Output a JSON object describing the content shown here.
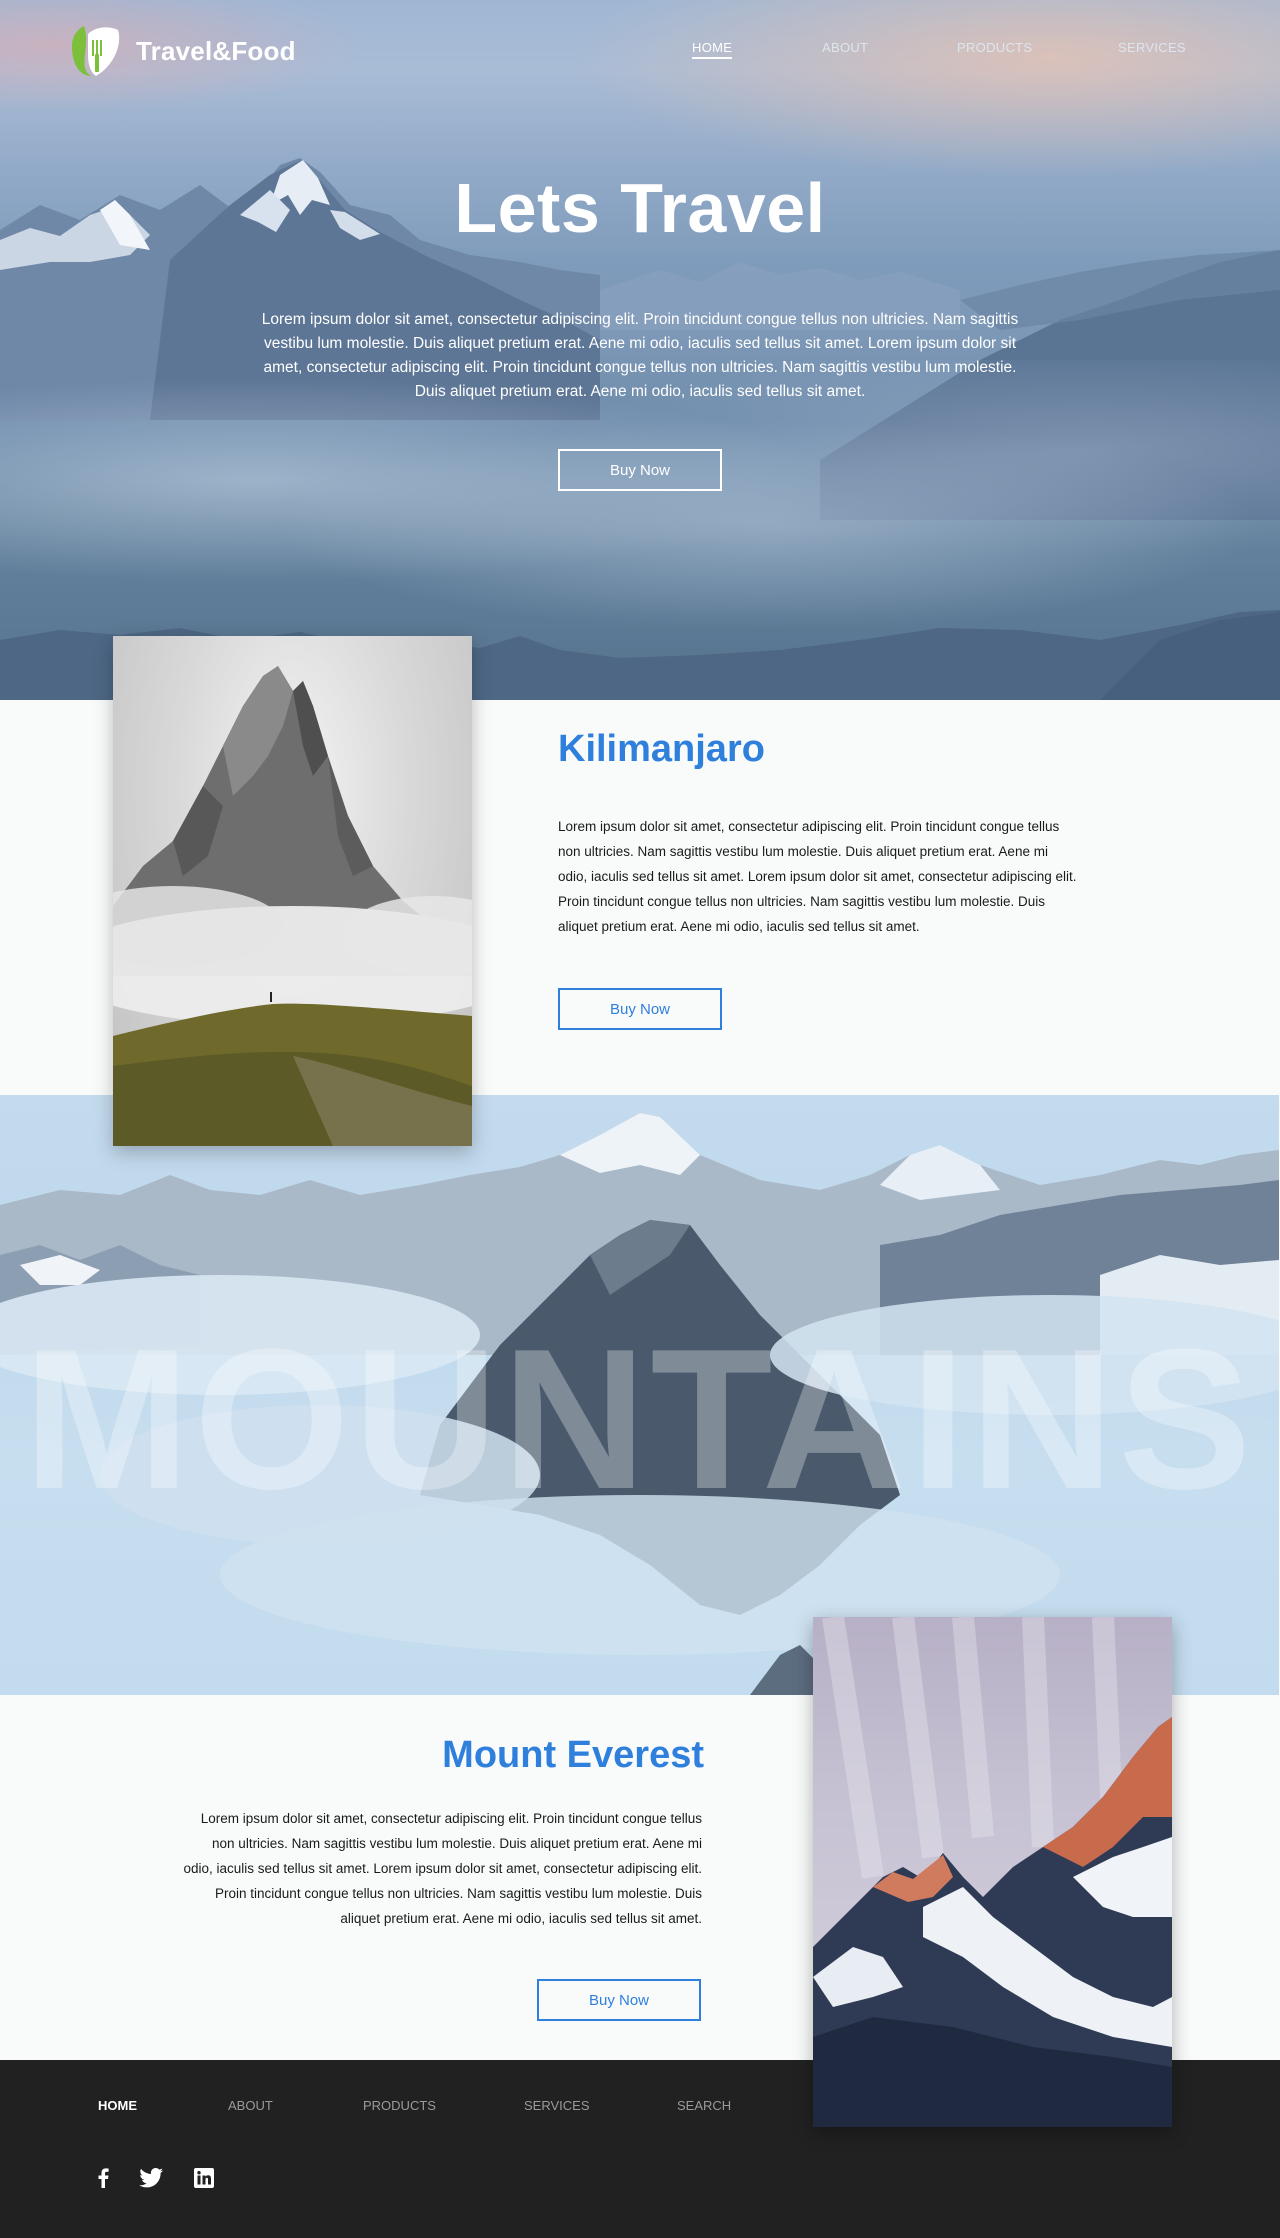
{
  "brand": {
    "name": "Travel&Food",
    "logo_icon": "leaf-fork-icon"
  },
  "nav": {
    "items": [
      "HOME",
      "ABOUT",
      "PRODUCTS",
      "SERVICES"
    ],
    "active": "HOME"
  },
  "hero": {
    "title": "Lets Travel",
    "text": "Lorem ipsum dolor sit amet, consectetur adipiscing elit. Proin tincidunt congue tellus non ultricies. Nam sagittis vestibu lum molestie. Duis aliquet pretium erat. Aene mi odio, iaculis sed tellus sit amet. Lorem ipsum dolor sit amet, consectetur adipiscing elit. Proin tincidunt congue tellus non ultricies. Nam sagittis vestibu lum molestie. Duis aliquet pretium erat. Aene mi odio, iaculis sed tellus sit amet.",
    "button": "Buy Now"
  },
  "section1": {
    "title": "Kilimanjaro",
    "text": "Lorem ipsum dolor sit amet, consectetur adipiscing elit. Proin tincidunt congue tellus non ultricies. Nam sagittis vestibu lum molestie. Duis aliquet pretium erat. Aene mi odio, iaculis sed tellus sit amet. Lorem ipsum dolor sit amet, consectetur adipiscing elit. Proin tincidunt congue tellus non ultricies. Nam sagittis vestibu lum molestie. Duis aliquet pretium erat. Aene mi odio, iaculis sed tellus sit amet.",
    "button": "Buy Now"
  },
  "band": {
    "word": "MOUNTAINS"
  },
  "section2": {
    "title": "Mount Everest",
    "text": "Lorem ipsum dolor sit amet, consectetur adipiscing elit. Proin tincidunt congue tellus non ultricies. Nam sagittis vestibu lum molestie. Duis aliquet pretium erat. Aene mi odio, iaculis sed tellus sit amet. Lorem ipsum dolor sit amet, consectetur adipiscing elit. Proin tincidunt congue tellus non ultricies. Nam sagittis vestibu lum molestie. Duis aliquet pretium erat. Aene mi odio, iaculis sed tellus sit amet.",
    "button": "Buy Now"
  },
  "footer": {
    "nav": [
      "HOME",
      "ABOUT",
      "PRODUCTS",
      "SERVICES",
      "SEARCH"
    ],
    "active": "HOME",
    "social": [
      "facebook-icon",
      "twitter-icon",
      "linkedin-icon"
    ]
  },
  "colors": {
    "accent": "#2f7fdc",
    "footer_bg": "#212121",
    "logo_green": "#7bbf3a"
  }
}
